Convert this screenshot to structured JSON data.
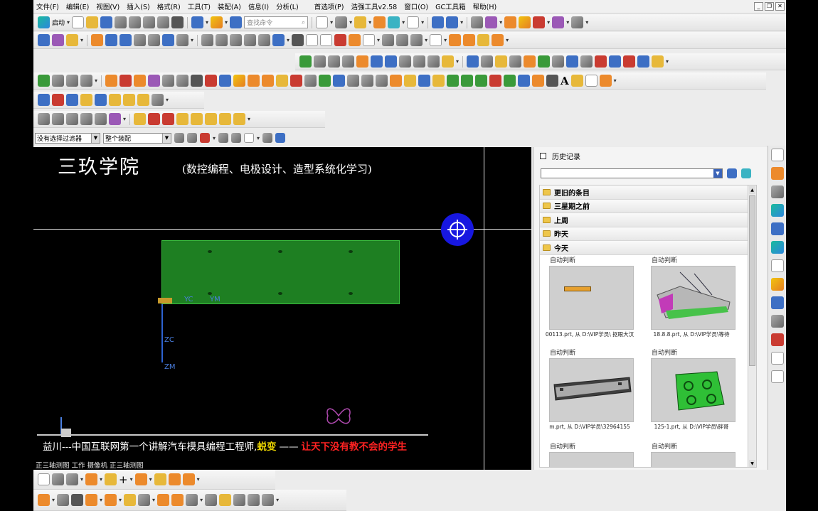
{
  "menu": [
    "文件(F)",
    "编辑(E)",
    "视图(V)",
    "插入(S)",
    "格式(R)",
    "工具(T)",
    "装配(A)",
    "信息(I)",
    "分析(L)",
    "首选项(P)",
    "浩强工具v2.58",
    "窗口(O)",
    "GC工具箱",
    "帮助(H)"
  ],
  "toolbar": {
    "start_label": "启动",
    "search_placeholder": "查找命令"
  },
  "filter": {
    "selection_filter": "没有选择过滤器",
    "scope": "整个装配"
  },
  "viewport": {
    "watermark_title": "三玖学院",
    "watermark_subtitle": "(数控编程、电极设计、造型系统化学习)",
    "axis_yc": "YC",
    "axis_ym": "YM",
    "axis_zc": "ZC",
    "axis_zm": "ZM",
    "footer_prefix": "益川---中国互联网第一个讲解汽车模具编程工程师,",
    "footer_highlight": "蜕变",
    "footer_dash": "——",
    "footer_red": "让天下没有教不会的学生",
    "view_name": "正三轴测图 工作 摄像机 正三轴测图"
  },
  "history": {
    "title": "历史记录",
    "groups": [
      "更旧的条目",
      "三星期之前",
      "上周",
      "昨天",
      "今天"
    ],
    "items": [
      {
        "label": "自动判断",
        "name": "00113.prt, 从 D:\\VIP学员\\ 抠眼大汉"
      },
      {
        "label": "自动判断",
        "name": "18.8.8.prt, 从 D:\\VIP学员\\等待"
      },
      {
        "label": "自动判断",
        "name": "m.prt, 从 D:\\VIP学员\\32964155"
      },
      {
        "label": "自动判断",
        "name": "125-1.prt, 从 D:\\VIP学员\\胖哥"
      },
      {
        "label": "自动判断",
        "name": ""
      },
      {
        "label": "自动判断",
        "name": ""
      }
    ]
  },
  "colors": {
    "plate": "#1e7f22",
    "cursor": "#1717e0",
    "highlight": "#e8d200",
    "red_text": "#ff2222"
  }
}
